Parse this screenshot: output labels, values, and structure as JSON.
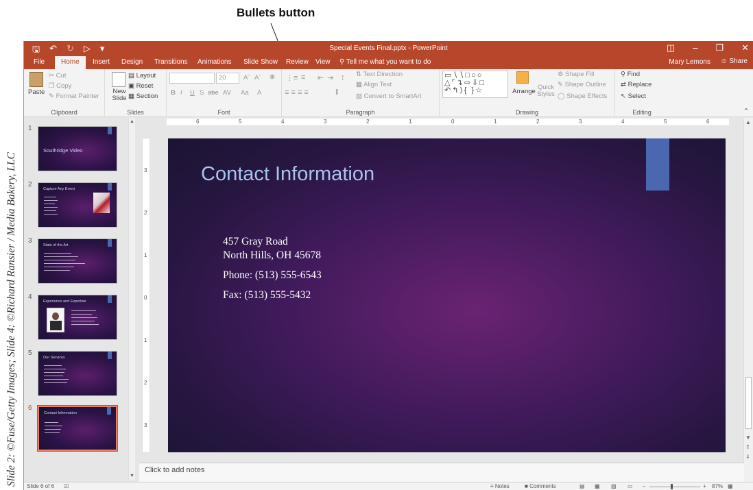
{
  "credit": "Slide 2: ©Fuse/Getty Images; Slide 4: ©Richard Ransier / Media Bakery, LLC",
  "callout": {
    "label": "Bullets button"
  },
  "window": {
    "title": "Special Events Final.pptx - PowerPoint",
    "qat": {
      "save_icon": "save-icon",
      "undo_icon": "undo-icon",
      "redo_icon": "redo-icon",
      "start_icon": "start-from-beginning-icon"
    }
  },
  "tabs": [
    "File",
    "Home",
    "Insert",
    "Design",
    "Transitions",
    "Animations",
    "Slide Show",
    "Review",
    "View"
  ],
  "tell_me": "Tell me what you want to do",
  "user": "Mary Lemons",
  "share": "Share",
  "ribbon": {
    "clipboard": {
      "name": "Clipboard",
      "paste": "Paste",
      "cut": "Cut",
      "copy": "Copy",
      "format_painter": "Format Painter"
    },
    "slides": {
      "name": "Slides",
      "new_slide": "New Slide",
      "layout": "Layout",
      "reset": "Reset",
      "section": "Section"
    },
    "font": {
      "name": "Font",
      "size": "20",
      "bold": "B",
      "italic": "I",
      "underline": "U",
      "shadow": "S",
      "strike": "abc",
      "spacing": "AV",
      "case": "Aa",
      "color": "A"
    },
    "paragraph": {
      "name": "Paragraph",
      "text_direction": "Text Direction",
      "align_text": "Align Text",
      "convert_smartart": "Convert to SmartArt"
    },
    "drawing": {
      "name": "Drawing",
      "arrange": "Arrange",
      "quick_styles": "Quick Styles",
      "shape_fill": "Shape Fill",
      "shape_outline": "Shape Outline",
      "shape_effects": "Shape Effects"
    },
    "editing": {
      "name": "Editing",
      "find": "Find",
      "replace": "Replace",
      "select": "Select"
    }
  },
  "thumbnails": [
    {
      "num": "1",
      "title": "Southridge Video"
    },
    {
      "num": "2",
      "title": "Capture Any Event"
    },
    {
      "num": "3",
      "title": "State of the Art"
    },
    {
      "num": "4",
      "title": "Experience and Expertise"
    },
    {
      "num": "5",
      "title": "Our Services"
    },
    {
      "num": "6",
      "title": "Contact Information"
    }
  ],
  "ruler": {
    "h": [
      "6",
      "5",
      "4",
      "3",
      "2",
      "1",
      "0",
      "1",
      "2",
      "3",
      "4",
      "5",
      "6"
    ],
    "v": [
      "3",
      "2",
      "1",
      "0",
      "1",
      "2",
      "3"
    ]
  },
  "slide": {
    "title": "Contact Information",
    "lines": [
      "457 Gray Road",
      "North Hills, OH 45678",
      "Phone: (513) 555-6543",
      "Fax: (513) 555-5432"
    ]
  },
  "notes_placeholder": "Click to add notes",
  "status": {
    "slide_count": "Slide 6 of 6",
    "notes": "Notes",
    "comments": "Comments",
    "zoom": "87%",
    "zoom_level": 0.87
  },
  "colors": {
    "ribbon_accent": "#b7472a",
    "slide_title": "#a9c4f0",
    "slide_accent": "#4a67b0"
  }
}
